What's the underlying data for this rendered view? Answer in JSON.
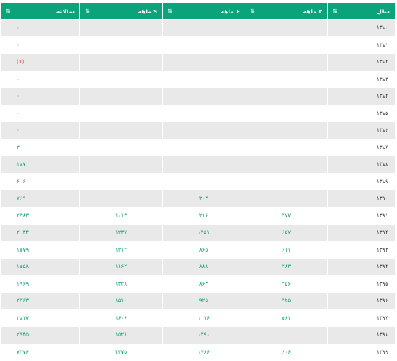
{
  "headers": [
    "سال",
    "۳ ماهه",
    "۶ ماهه",
    "۹ ماهه",
    "سالانه"
  ],
  "sort_glyph": "⇅",
  "rows": [
    {
      "year": "۱۳۸۰",
      "q3": "",
      "q6": "",
      "q9": "",
      "annual": "۰"
    },
    {
      "year": "۱۳۸۱",
      "q3": "",
      "q6": "",
      "q9": "",
      "annual": "۰"
    },
    {
      "year": "۱۳۸۲",
      "q3": "",
      "q6": "",
      "q9": "",
      "annual": "(۶)"
    },
    {
      "year": "۱۳۸۳",
      "q3": "",
      "q6": "",
      "q9": "",
      "annual": "۰"
    },
    {
      "year": "۱۳۸۴",
      "q3": "",
      "q6": "",
      "q9": "",
      "annual": "۰"
    },
    {
      "year": "۱۳۸۵",
      "q3": "",
      "q6": "",
      "q9": "",
      "annual": "۰"
    },
    {
      "year": "۱۳۸۶",
      "q3": "",
      "q6": "",
      "q9": "",
      "annual": "۰"
    },
    {
      "year": "۱۳۸۷",
      "q3": "",
      "q6": "",
      "q9": "",
      "annual": "۳"
    },
    {
      "year": "۱۳۸۸",
      "q3": "",
      "q6": "",
      "q9": "",
      "annual": "۱۸۷"
    },
    {
      "year": "۱۳۸۹",
      "q3": "",
      "q6": "",
      "q9": "",
      "annual": "۶۰۶"
    },
    {
      "year": "۱۳۹۰",
      "q3": "",
      "q6": "۳۰۳",
      "q9": "",
      "annual": "۷۶۹"
    },
    {
      "year": "۱۳۹۱",
      "q3": "۲۷۷",
      "q6": "۲۱۶",
      "q9": "۱۰۱۳",
      "annual": "۲۳۸۳"
    },
    {
      "year": "۱۳۹۲",
      "q3": "۶۵۷",
      "q6": "۱۴۵۱",
      "q9": "۱۲۳۷",
      "annual": "۲۰۳۴"
    },
    {
      "year": "۱۳۹۳",
      "q3": "۶۱۱",
      "q6": "۸۶۵",
      "q9": "۱۲۱۲",
      "annual": "۱۵۷۹"
    },
    {
      "year": "۱۳۹۴",
      "q3": "۲۸۳",
      "q6": "۸۸۸",
      "q9": "۱۱۶۲",
      "annual": "۱۵۵۸"
    },
    {
      "year": "۱۳۹۵",
      "q3": "۲۵۶",
      "q6": "۸۶۳",
      "q9": "۱۳۲۸",
      "annual": "۱۷۶۹"
    },
    {
      "year": "۱۳۹۶",
      "q3": "۴۲۵",
      "q6": "۹۲۵",
      "q9": "۱۵۱۰",
      "annual": "۲۲۶۳"
    },
    {
      "year": "۱۳۹۷",
      "q3": "۵۶۱",
      "q6": "۱۰۱۶",
      "q9": "۱۶۰۶",
      "annual": "۲۸۱۷"
    },
    {
      "year": "۱۳۹۸",
      "q3": "",
      "q6": "۱۲۹۰",
      "q9": "۱۵۲۸",
      "annual": "۲۷۴۵"
    },
    {
      "year": "۱۳۹۹",
      "q3": "۶۰۶",
      "q6": "۱۷۶۶",
      "q9": "۳۴۷۵",
      "annual": "۷۳۷۶"
    }
  ],
  "colors": {
    "header_bg": "#0aa37a",
    "value_text": "#0e9c74",
    "negative_text": "#d9362b",
    "stripe": "#e9e9e9"
  }
}
